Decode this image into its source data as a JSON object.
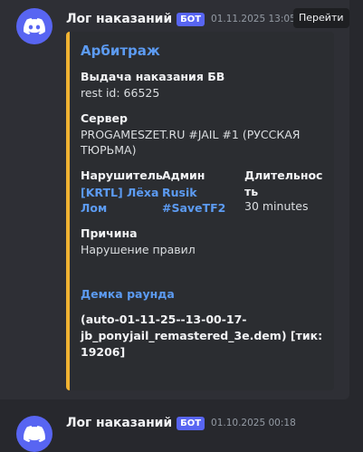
{
  "message": {
    "username": "Лог наказаний",
    "badge": "БОТ",
    "timestamp": "01.11.2025 13:05",
    "goto_label": "Перейти",
    "avatar_icon": "discord-logo-icon",
    "accent_color": "#f0b232"
  },
  "embed": {
    "title": "Арбитраж",
    "fields": {
      "punishment": {
        "name": "Выдача наказания БВ",
        "value": "rest id: 66525"
      },
      "server": {
        "name": "Сервер",
        "value_line1": "PROGAMESZET.RU #JAIL #1 (РУССКАЯ",
        "value_line2": "ТЮРЬМА)"
      },
      "offender": {
        "name": "Нарушитель",
        "value_line1": "[KRTL] Лёха",
        "value_line2": "Лом"
      },
      "admin": {
        "name": "Админ",
        "value_line1": "Rusik",
        "value_line2": "#SaveTF2"
      },
      "duration": {
        "name_line1": "Длительнос",
        "name_line2": "ть",
        "value": "30 minutes"
      },
      "reason": {
        "name": "Причина",
        "value": "Нарушение правил"
      },
      "demo": {
        "name": "Демка раунда",
        "value_line1": "(auto-01-11-25--13-00-17-",
        "value_line2": "jb_ponyjail_remastered_3e.dem) [тик:",
        "value_line3": "19206]"
      }
    }
  },
  "next_message": {
    "username": "Лог наказаний",
    "badge": "БОТ",
    "timestamp": "01.10.2025 00:18"
  }
}
